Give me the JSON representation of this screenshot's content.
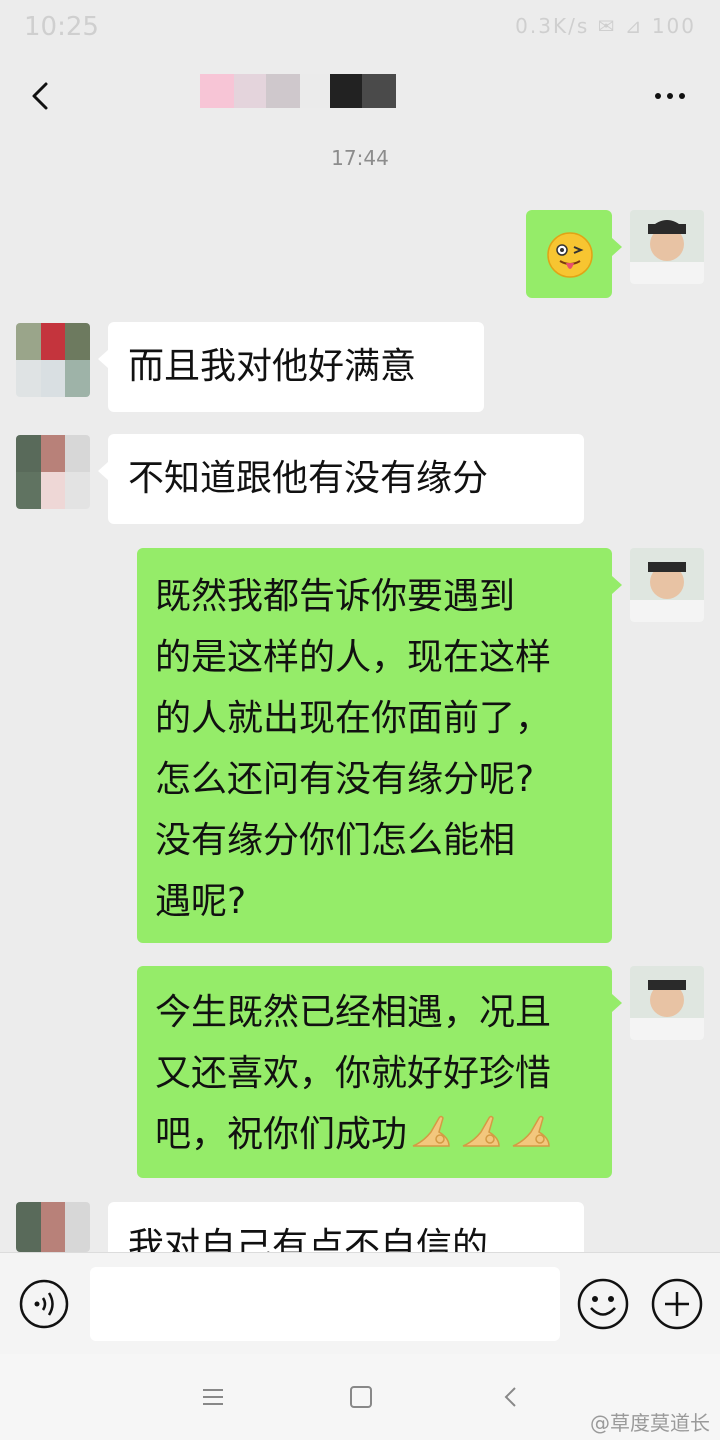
{
  "status_bar": {
    "time": "10:25",
    "indicators": "0.3K/s ✉ ⊿ 100"
  },
  "header": {
    "back_icon": "chevron-left-icon",
    "more_icon": "more-dots-icon",
    "title": ""
  },
  "timestamp": "17:44",
  "messages": [
    {
      "side": "right",
      "content": "wink-tongue-emoji"
    },
    {
      "side": "left",
      "text": "而且我对他好满意"
    },
    {
      "side": "left",
      "text": "不知道跟他有没有缘分"
    },
    {
      "side": "right",
      "lines": [
        "既然我都告诉你要遇到",
        "的是这样的人，现在这样",
        "的人就出现在你面前了，",
        "怎么还问有没有缘分呢?",
        "没有缘分你们怎么能相",
        "遇呢?"
      ]
    },
    {
      "side": "right",
      "lines": [
        "今生既然已经相遇，况且",
        "又还喜欢，你就好好珍惜",
        "吧，祝你们成功"
      ],
      "trailing_emoji": "ok-hand-emoji ×3"
    },
    {
      "side": "left",
      "text": "我对自己有点不自信的"
    }
  ],
  "input_bar": {
    "voice_icon": "voice-icon",
    "text_value": "",
    "emoji_icon": "smiley-icon",
    "plus_icon": "plus-icon"
  },
  "nav_bar": {
    "icons": [
      "menu-icon",
      "home-square-icon",
      "back-triangle-icon"
    ]
  },
  "watermark": "@草度莫道长",
  "colors": {
    "background": "#ececec",
    "my_bubble": "#95ec69",
    "their_bubble": "#ffffff",
    "input_bar": "#f4f4f4"
  }
}
